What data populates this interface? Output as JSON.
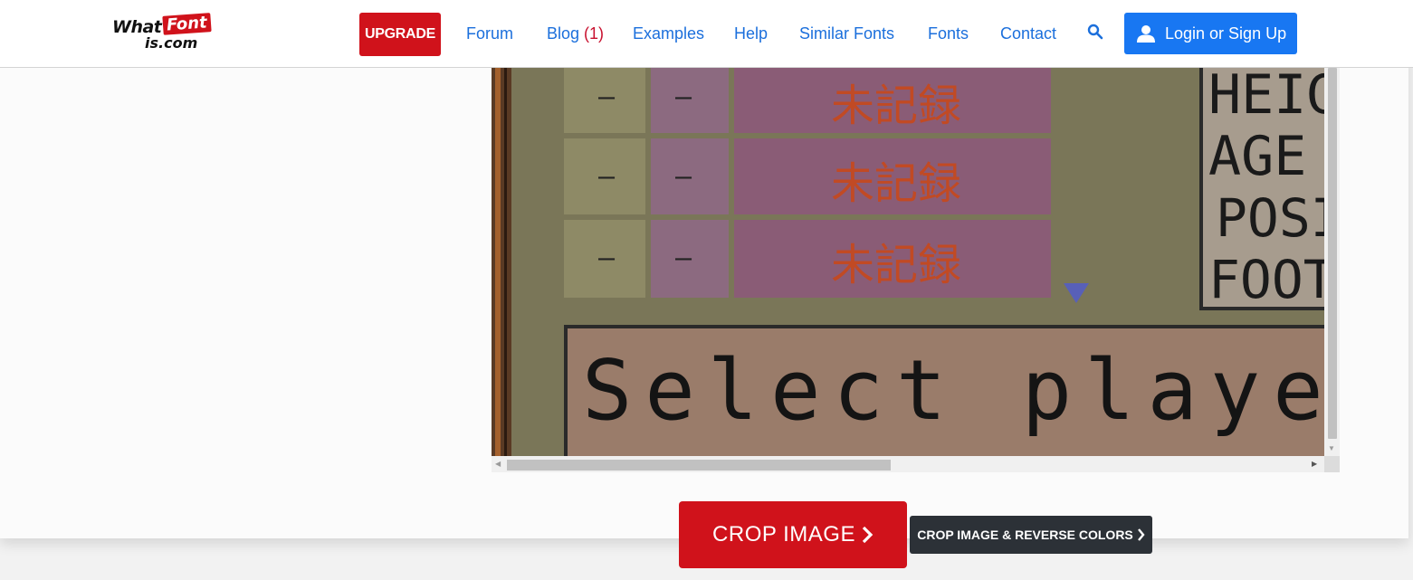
{
  "header": {
    "logo_what": "What",
    "logo_font": "Font",
    "logo_domain": "is.com",
    "upgrade_label": "UPGRADE",
    "nav": {
      "forum": "Forum",
      "blog": "Blog",
      "blog_count": "(1)",
      "examples": "Examples",
      "help": "Help",
      "similar_fonts": "Similar Fonts",
      "fonts": "Fonts",
      "contact": "Contact"
    },
    "search_icon": "search-icon",
    "login_label": "Login or Sign Up",
    "login_icon": "user-icon"
  },
  "viewer": {
    "table_cells": [
      "–",
      "–",
      "–",
      "–",
      "–",
      "–"
    ],
    "kanji": [
      "未記録",
      "未記録",
      "未記録"
    ],
    "stat_labels": [
      "HEIG",
      "AGE",
      "POSI",
      "FOOT"
    ],
    "message": "Select player"
  },
  "actions": {
    "crop_label": "CROP IMAGE",
    "crop_reverse_label": "CROP IMAGE & REVERSE COLORS"
  },
  "colors": {
    "brand_red": "#d0121b",
    "link_blue": "#1b6fdc",
    "login_blue": "#1877f2",
    "dark_button": "#2c3137"
  }
}
